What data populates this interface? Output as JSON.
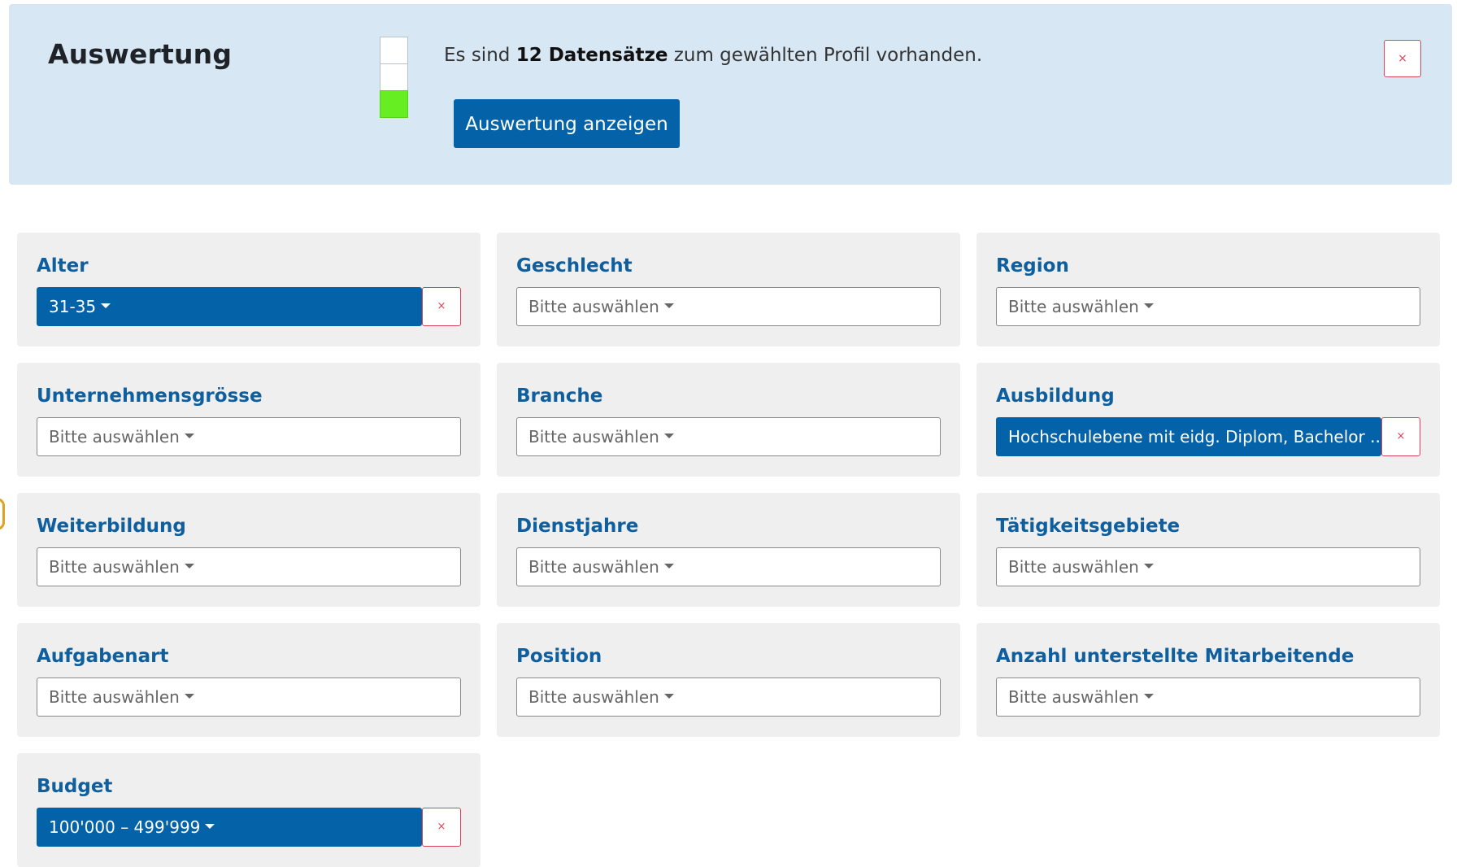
{
  "banner": {
    "title": "Auswertung",
    "text_prefix": "Es sind ",
    "count_text": "12 Datensätze",
    "text_suffix": " zum gewählten Profil vorhanden.",
    "button_label": "Auswertung anzeigen",
    "close_label": "×",
    "indicator_level": "3 of 3 (lowest cell filled green)",
    "indicator_color": "#66ee22"
  },
  "filters": [
    {
      "label": "Alter",
      "value": "31-35",
      "selected": true,
      "clear_label": "×"
    },
    {
      "label": "Geschlecht",
      "value": "Bitte auswählen",
      "selected": false
    },
    {
      "label": "Region",
      "value": "Bitte auswählen",
      "selected": false
    },
    {
      "label": "Unternehmensgrösse",
      "value": "Bitte auswählen",
      "selected": false
    },
    {
      "label": "Branche",
      "value": "Bitte auswählen",
      "selected": false
    },
    {
      "label": "Ausbildung",
      "value": "Hochschulebene mit eidg. Diplom, Bachelor ...",
      "selected": true,
      "clear_label": "×"
    },
    {
      "label": "Weiterbildung",
      "value": "Bitte auswählen",
      "selected": false
    },
    {
      "label": "Dienstjahre",
      "value": "Bitte auswählen",
      "selected": false
    },
    {
      "label": "Tätigkeitsgebiete",
      "value": "Bitte auswählen",
      "selected": false
    },
    {
      "label": "Aufgabenart",
      "value": "Bitte auswählen",
      "selected": false
    },
    {
      "label": "Position",
      "value": "Bitte auswählen",
      "selected": false
    },
    {
      "label": "Anzahl unterstellte Mitarbeitende",
      "value": "Bitte auswählen",
      "selected": false
    },
    {
      "label": "Budget",
      "value": "100'000 – 499'999",
      "selected": true,
      "clear_label": "×"
    }
  ],
  "colors": {
    "banner_bg": "#d7e7f4",
    "primary": "#0463a8",
    "label": "#0f5f9e",
    "clear": "#d9435a",
    "card_bg": "#efefef"
  }
}
